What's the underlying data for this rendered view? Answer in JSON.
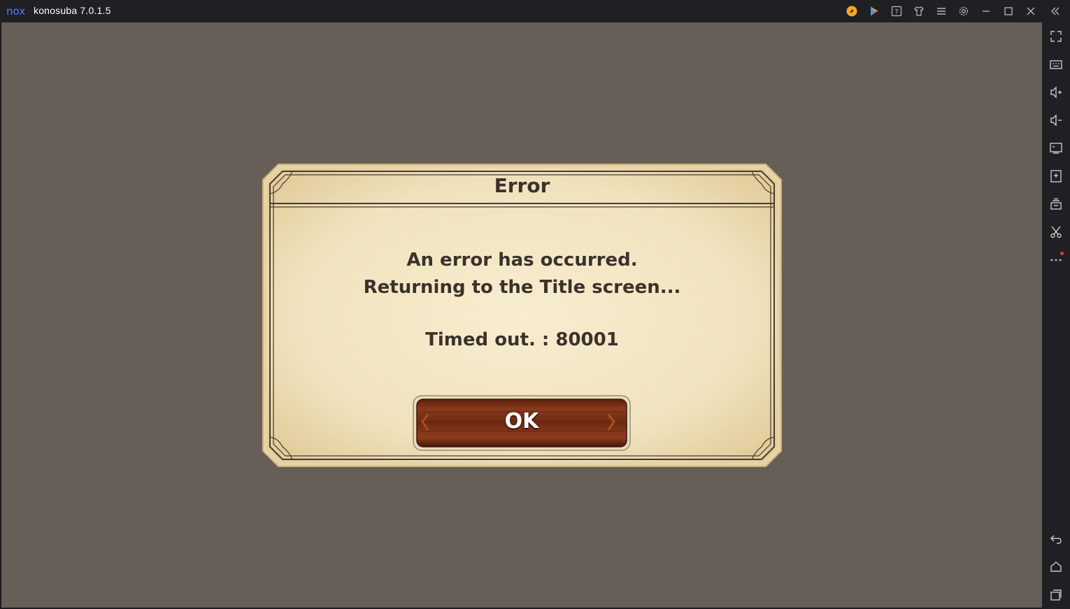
{
  "window": {
    "app_title": "konosuba 7.0.1.5",
    "logo_text": "nox"
  },
  "titlebar_icons": [
    "compass-icon",
    "play-store-icon",
    "help-icon",
    "shirt-icon",
    "menu-icon",
    "settings-icon",
    "minimize-icon",
    "maximize-icon",
    "close-icon",
    "collapse-sidebar-icon"
  ],
  "sidebar_icons": [
    "fullscreen-icon",
    "keyboard-icon",
    "volume-up-icon",
    "volume-down-icon",
    "screen-icon",
    "add-apk-icon",
    "multi-instance-icon",
    "screenshot-scissors-icon",
    "more-icon",
    "back-icon",
    "home-icon",
    "recent-apps-icon"
  ],
  "dialog": {
    "title": "Error",
    "message_line1": "An error has occurred.",
    "message_line2": "Returning to the Title screen...",
    "error_code": "Timed out. : 80001",
    "ok_label": "OK"
  },
  "colors": {
    "screen_background": "#675e58",
    "chrome_background": "#1f1f24",
    "parchment": "#f3e6c4",
    "button_brown": "#7a2a12",
    "notification_dot": "#e53935"
  }
}
